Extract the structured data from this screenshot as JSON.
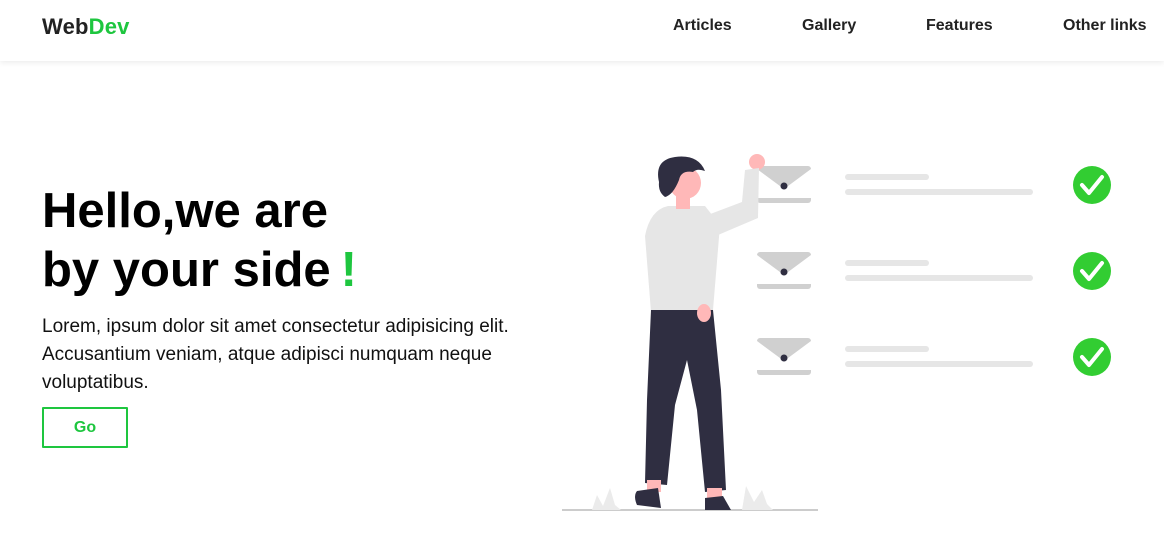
{
  "header": {
    "logo_part1": "Web",
    "logo_part2": "Dev",
    "nav": [
      {
        "label": "Articles"
      },
      {
        "label": "Gallery"
      },
      {
        "label": "Features"
      },
      {
        "label": "Other links"
      }
    ]
  },
  "hero": {
    "title_line1": "Hello,we are",
    "title_line2": "by your side",
    "title_mark": "!",
    "text": "Lorem, ipsum dolor sit amet consectetur adipisicing elit. Accusantium veniam, atque adipisci numquam neque voluptatibus.",
    "button_label": "Go"
  },
  "colors": {
    "accent": "#1ec63f",
    "text": "#111111",
    "figure_shirt": "#e6e6e6",
    "figure_pants": "#2f2e41",
    "skin": "#ffb8b8",
    "envelope": "#cccccc",
    "check_green": "#32cd32"
  },
  "illustration": {
    "icon": "person-checklist-illustration",
    "rows": [
      {
        "checked": true
      },
      {
        "checked": true
      },
      {
        "checked": true
      }
    ]
  }
}
